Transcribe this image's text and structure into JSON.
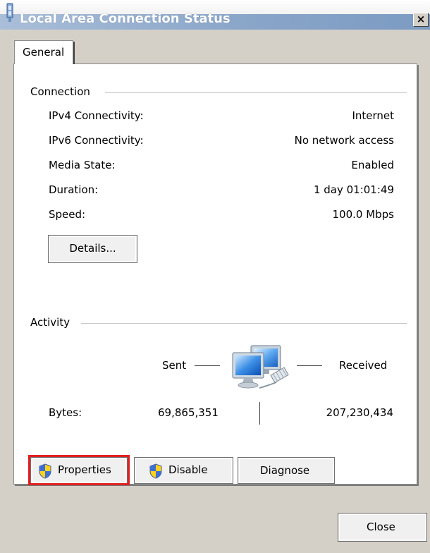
{
  "window": {
    "title": "Local Area Connection Status",
    "close_glyph": "×",
    "accent_color": "#8aa6c9"
  },
  "tabs": [
    {
      "label": "General",
      "selected": true
    }
  ],
  "connection": {
    "group_title": "Connection",
    "rows": [
      {
        "label": "IPv4 Connectivity:",
        "value": "Internet"
      },
      {
        "label": "IPv6 Connectivity:",
        "value": "No network access"
      },
      {
        "label": "Media State:",
        "value": "Enabled"
      },
      {
        "label": "Duration:",
        "value": "1 day 01:01:49"
      },
      {
        "label": "Speed:",
        "value": "100.0 Mbps"
      }
    ],
    "details_button": "Details..."
  },
  "activity": {
    "group_title": "Activity",
    "sent_label": "Sent",
    "received_label": "Received",
    "bytes_label": "Bytes:",
    "bytes_sent": "69,865,351",
    "bytes_received": "207,230,434",
    "icon": "network-computers-icon"
  },
  "buttons": {
    "properties": "Properties",
    "disable": "Disable",
    "diagnose": "Diagnose",
    "close": "Close"
  },
  "icons": {
    "title": "network-adapter-icon",
    "shield": "uac-shield-icon"
  },
  "highlight_color": "#e02020"
}
